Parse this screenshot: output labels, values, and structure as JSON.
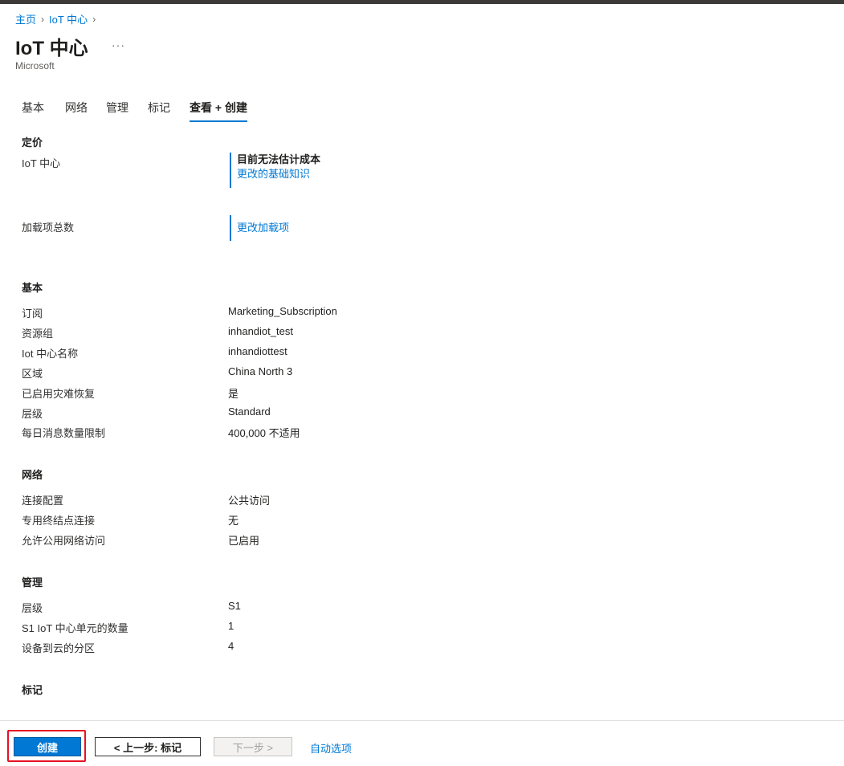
{
  "breadcrumb": {
    "home": "主页",
    "current": "IoT 中心",
    "sep": "›"
  },
  "header": {
    "title": "IoT 中心",
    "more": "···",
    "publisher": "Microsoft"
  },
  "tabs": [
    {
      "label": "基本"
    },
    {
      "label": "网络"
    },
    {
      "label": "管理"
    },
    {
      "label": "标记"
    },
    {
      "label": "查看 + 创建",
      "active": true
    }
  ],
  "pricing": {
    "heading": "定价",
    "iot_label": "IoT 中心",
    "iot_status": "目前无法估计成本",
    "iot_link": "更改的基础知识",
    "addons_label": "加载项总数",
    "addons_link": "更改加载项"
  },
  "basics": {
    "heading": "基本",
    "rows": [
      {
        "label": "订阅",
        "value": "Marketing_Subscription"
      },
      {
        "label": "资源组",
        "value": "inhandiot_test"
      },
      {
        "label": "Iot 中心名称",
        "value": "inhandiottest"
      },
      {
        "label": "区域",
        "value": "China North 3"
      },
      {
        "label": "已启用灾难恢复",
        "value": "是"
      },
      {
        "label": "层级",
        "value": "Standard"
      },
      {
        "label": "每日消息数量限制",
        "value": "400,000 不适用"
      }
    ]
  },
  "networking": {
    "heading": "网络",
    "rows": [
      {
        "label": "连接配置",
        "value": "公共访问"
      },
      {
        "label": "专用终结点连接",
        "value": "无"
      },
      {
        "label": "允许公用网络访问",
        "value": "已启用"
      }
    ]
  },
  "management": {
    "heading": "管理",
    "rows": [
      {
        "label": "层级",
        "value": "S1"
      },
      {
        "label": "S1 IoT 中心单元的数量",
        "value": "1"
      },
      {
        "label": "设备到云的分区",
        "value": "4"
      }
    ]
  },
  "tags": {
    "heading": "标记"
  },
  "footer": {
    "create": "创建",
    "prev": "< 上一步: 标记",
    "next": "下一步 >",
    "automation": "自动选项"
  },
  "colors": {
    "accent": "#0078d4",
    "highlight": "#e81123"
  }
}
